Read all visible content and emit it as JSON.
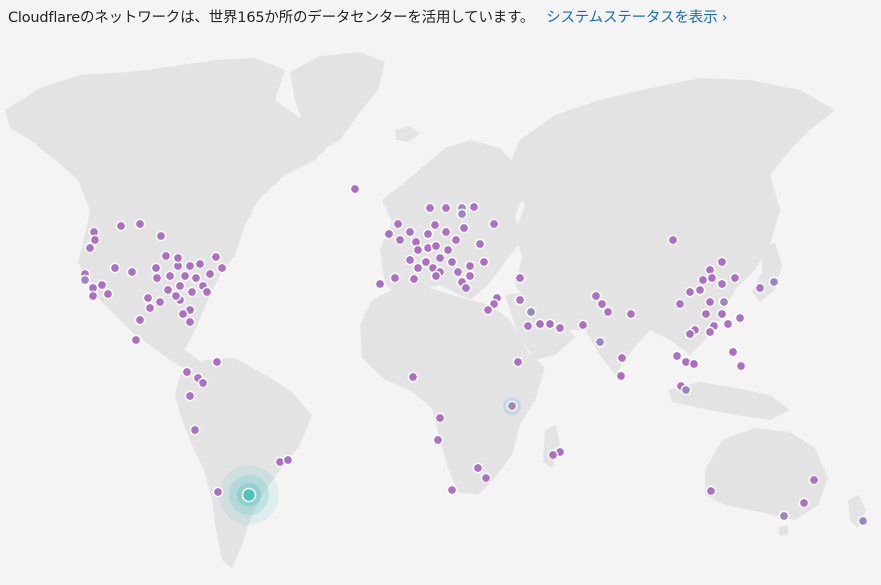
{
  "header": {
    "text": "Cloudflareのネットワークは、世界165か所のデータセンターを活用しています。",
    "link": "システムステータスを表示 ›"
  },
  "colors": {
    "background": "#f4f4f4",
    "land": "#e3e3e3",
    "datacenter": "#ad6fc4",
    "datacenter_alt": "#9a86c2",
    "highlight": "#4fc4bf",
    "link": "#1a6db5"
  },
  "map": {
    "icon": "datacenter-dot-icon"
  }
}
